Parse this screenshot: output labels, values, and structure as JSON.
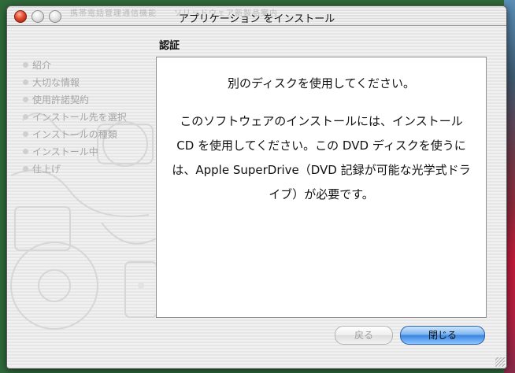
{
  "window": {
    "title": "アプリケーション をインストール",
    "background_title": "携帯電話管理通信機能　　ソリッドウェア新製品案内"
  },
  "sidebar": {
    "steps": [
      {
        "label": "紹介"
      },
      {
        "label": "大切な情報"
      },
      {
        "label": "使用許諾契約"
      },
      {
        "label": "インストール先を選択"
      },
      {
        "label": "インストールの種類"
      },
      {
        "label": "インストール中"
      },
      {
        "label": "仕上げ"
      }
    ]
  },
  "main": {
    "section_title": "認証",
    "heading": "別のディスクを使用してください。",
    "body": "このソフトウェアのインストールには、インストール CD を使用してください。この DVD ディスクを使うには、Apple SuperDrive（DVD 記録が可能な光学式ドライブ）が必要です。"
  },
  "buttons": {
    "back_label": "戻る",
    "close_label": "閉じる"
  },
  "colors": {
    "accent": "#3a86e0",
    "close_red": "#e24a2c"
  }
}
